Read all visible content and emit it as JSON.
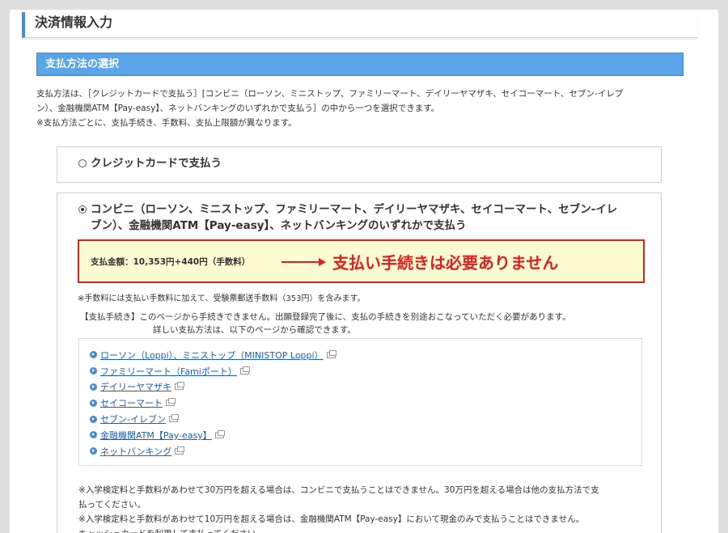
{
  "page": {
    "title": "決済情報入力"
  },
  "section": {
    "title": "支払方法の選択"
  },
  "intro": {
    "line1": "支払方法は、［クレジットカードで支払う］[コンビニ（ローソン、ミニストップ、ファミリーマート、デイリーヤマザキ、セイコーマート、セブン-イレブ",
    "line2": "ン）、金融機関ATM【Pay-easy】、ネットバンキングのいずれかで支払う］の中から一つを選択できます。",
    "line3": "※支払方法ごとに、支払手続き、手数料、支払上限額が異なります。"
  },
  "options": [
    {
      "label": "クレジットカードで支払う",
      "selected": false
    },
    {
      "label_line1": "コンビニ（ローソン、ミニストップ、ファミリーマート、デイリーヤマザキ、セイコーマート、セブン-イレ",
      "label_line2": "ブン）、金融機関ATM【Pay-easy】、ネットバンキングのいずれかで支払う",
      "selected": true
    }
  ],
  "amount": {
    "text": "支払金額：10,353円+440円（手数料）",
    "callout": "支払い手続きは必要ありません",
    "callout_color": "#e02020"
  },
  "fee_note": "※手数料には支払い手数料に加えて、受験票郵送手数料（353円）を含みます。",
  "procedure": {
    "line1": "【支払手続き】このページから手続きできません。出願登録完了後に、支払の手続きを別途おこなっていただく必要があります。",
    "line2": "詳しい支払方法は、以下のページから確認できます。"
  },
  "links": [
    "ローソン（Loppi）、ミニストップ（MINISTOP Loppi）",
    "ファミリーマート（Famiポート）",
    "デイリーヤマザキ",
    "セイコーマート",
    "セブン-イレブン",
    "金融機関ATM【Pay-easy】",
    "ネットバンキング"
  ],
  "bottom_notes": {
    "line1": "※入学検定料と手数料があわせて30万円を超える場合は、コンビニで支払うことはできません。30万円を超える場合は他の支払方法で支",
    "line2": "払ってください。",
    "line3": "※入学検定料と手数料があわせて10万円を超える場合は、金融機関ATM【Pay-easy】において現金のみで支払うことはできません。",
    "line4": "キャッシュカードを利用して支払ってください。"
  },
  "colors": {
    "accent": "#3f8fd4",
    "section_bar": "#5aa4e9",
    "link": "#1a5fb4",
    "highlight_bg": "#fdfbd1"
  }
}
